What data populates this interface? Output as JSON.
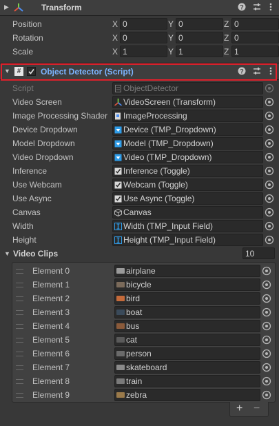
{
  "transform": {
    "title": "Transform",
    "rows": [
      {
        "label": "Position",
        "x": "0",
        "y": "0",
        "z": "0"
      },
      {
        "label": "Rotation",
        "x": "0",
        "y": "0",
        "z": "0"
      },
      {
        "label": "Scale",
        "x": "1",
        "y": "1",
        "z": "1"
      }
    ],
    "axes": {
      "x": "X",
      "y": "Y",
      "z": "Z"
    }
  },
  "component": {
    "title": "Object Detector (Script)",
    "enabled": true,
    "highlight_color": "#e0202b",
    "title_color": "#7cb4ff",
    "fields": [
      {
        "label": "Script",
        "value": "ObjectDetector",
        "icon": "script-icon",
        "disabled": true
      },
      {
        "label": "Video Screen",
        "value": "VideoScreen (Transform)",
        "icon": "transform-icon"
      },
      {
        "label": "Image Processing Shader",
        "value": "ImageProcessing",
        "icon": "shader-icon"
      },
      {
        "label": "Device Dropdown",
        "value": "Device (TMP_Dropdown)",
        "icon": "dropdown-icon"
      },
      {
        "label": "Model Dropdown",
        "value": "Model (TMP_Dropdown)",
        "icon": "dropdown-icon"
      },
      {
        "label": "Video Dropdown",
        "value": "Video (TMP_Dropdown)",
        "icon": "dropdown-icon"
      },
      {
        "label": "Inference",
        "value": "Inference (Toggle)",
        "icon": "toggle-icon"
      },
      {
        "label": "Use Webcam",
        "value": "Webcam (Toggle)",
        "icon": "toggle-icon"
      },
      {
        "label": "Use Async",
        "value": "Use Async (Toggle)",
        "icon": "toggle-icon"
      },
      {
        "label": "Canvas",
        "value": "Canvas",
        "icon": "canvas-icon"
      },
      {
        "label": "Width",
        "value": "Width (TMP_Input Field)",
        "icon": "input-field-icon"
      },
      {
        "label": "Height",
        "value": "Height (TMP_Input Field)",
        "icon": "input-field-icon"
      }
    ]
  },
  "video_clips": {
    "label": "Video Clips",
    "size": "10",
    "elements": [
      {
        "label": "Element 0",
        "value": "airplane"
      },
      {
        "label": "Element 1",
        "value": "bicycle"
      },
      {
        "label": "Element 2",
        "value": "bird"
      },
      {
        "label": "Element 3",
        "value": "boat"
      },
      {
        "label": "Element 4",
        "value": "bus"
      },
      {
        "label": "Element 5",
        "value": "cat"
      },
      {
        "label": "Element 6",
        "value": "person"
      },
      {
        "label": "Element 7",
        "value": "skateboard"
      },
      {
        "label": "Element 8",
        "value": "train"
      },
      {
        "label": "Element 9",
        "value": "zebra"
      }
    ],
    "add_label": "+",
    "remove_label": "−"
  }
}
